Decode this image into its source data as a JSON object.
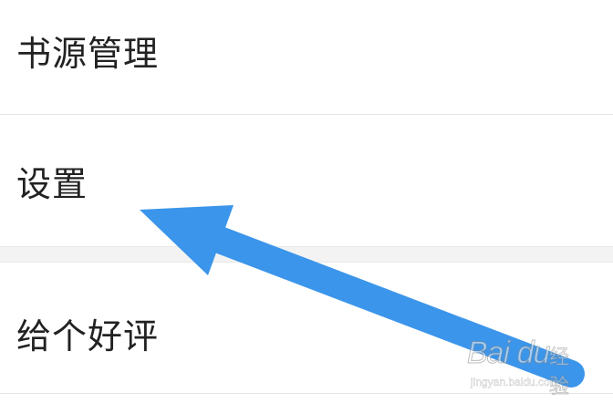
{
  "menu": {
    "items": [
      {
        "label": "书源管理"
      },
      {
        "label": "设置"
      },
      {
        "label": "给个好评"
      }
    ]
  },
  "annotation": {
    "icon": "pointer-arrow-icon",
    "color": "#3b95ea"
  },
  "watermark": {
    "brand": "Bai du",
    "brand_cn": "经验",
    "url": "jingyan.baidu.com"
  }
}
